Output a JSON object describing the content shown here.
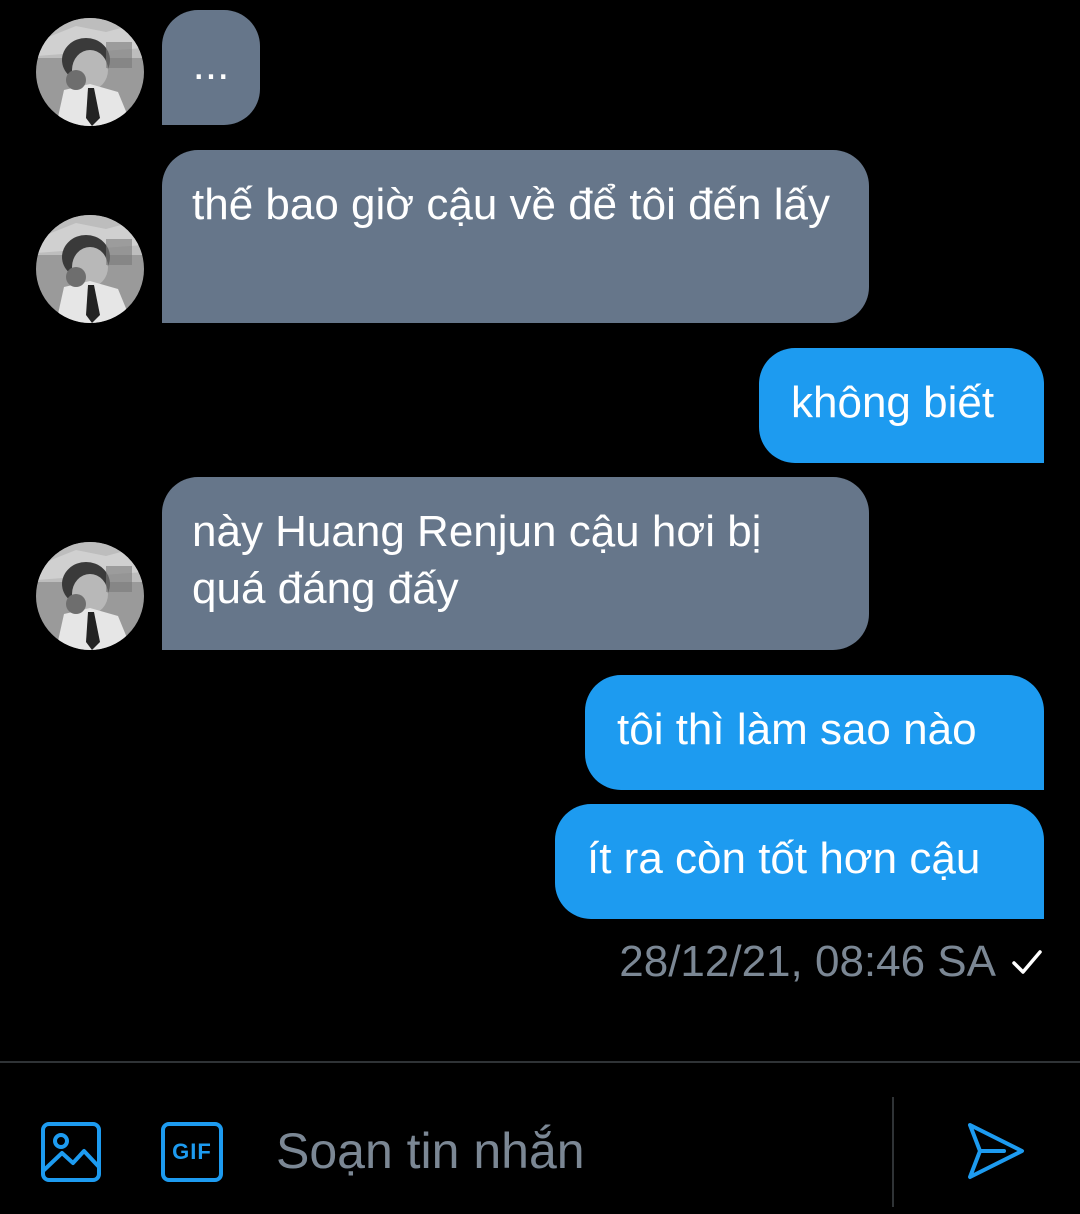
{
  "messages": [
    {
      "direction": "in",
      "text": "..."
    },
    {
      "direction": "in",
      "text": "thế bao giờ cậu về để tôi đến lấy"
    },
    {
      "direction": "out",
      "text": "không biết"
    },
    {
      "direction": "in",
      "text": "này Huang Renjun cậu hơi bị quá đáng đấy"
    },
    {
      "direction": "out",
      "text": "tôi thì làm sao nào"
    },
    {
      "direction": "out",
      "text": "ít ra còn tốt hơn cậu"
    }
  ],
  "last_message_status": {
    "timestamp": "28/12/21, 08:46 SA",
    "icon": "check-icon"
  },
  "composer": {
    "placeholder": "Soạn tin nhắn",
    "value": "",
    "gif_label": "GIF",
    "image_icon": "image-icon",
    "send_icon": "send-icon"
  },
  "colors": {
    "background": "#000000",
    "incoming_bubble": "#66768a",
    "outgoing_bubble": "#1d9bf0",
    "accent": "#1d9bf0",
    "secondary_text": "#7b8794"
  }
}
